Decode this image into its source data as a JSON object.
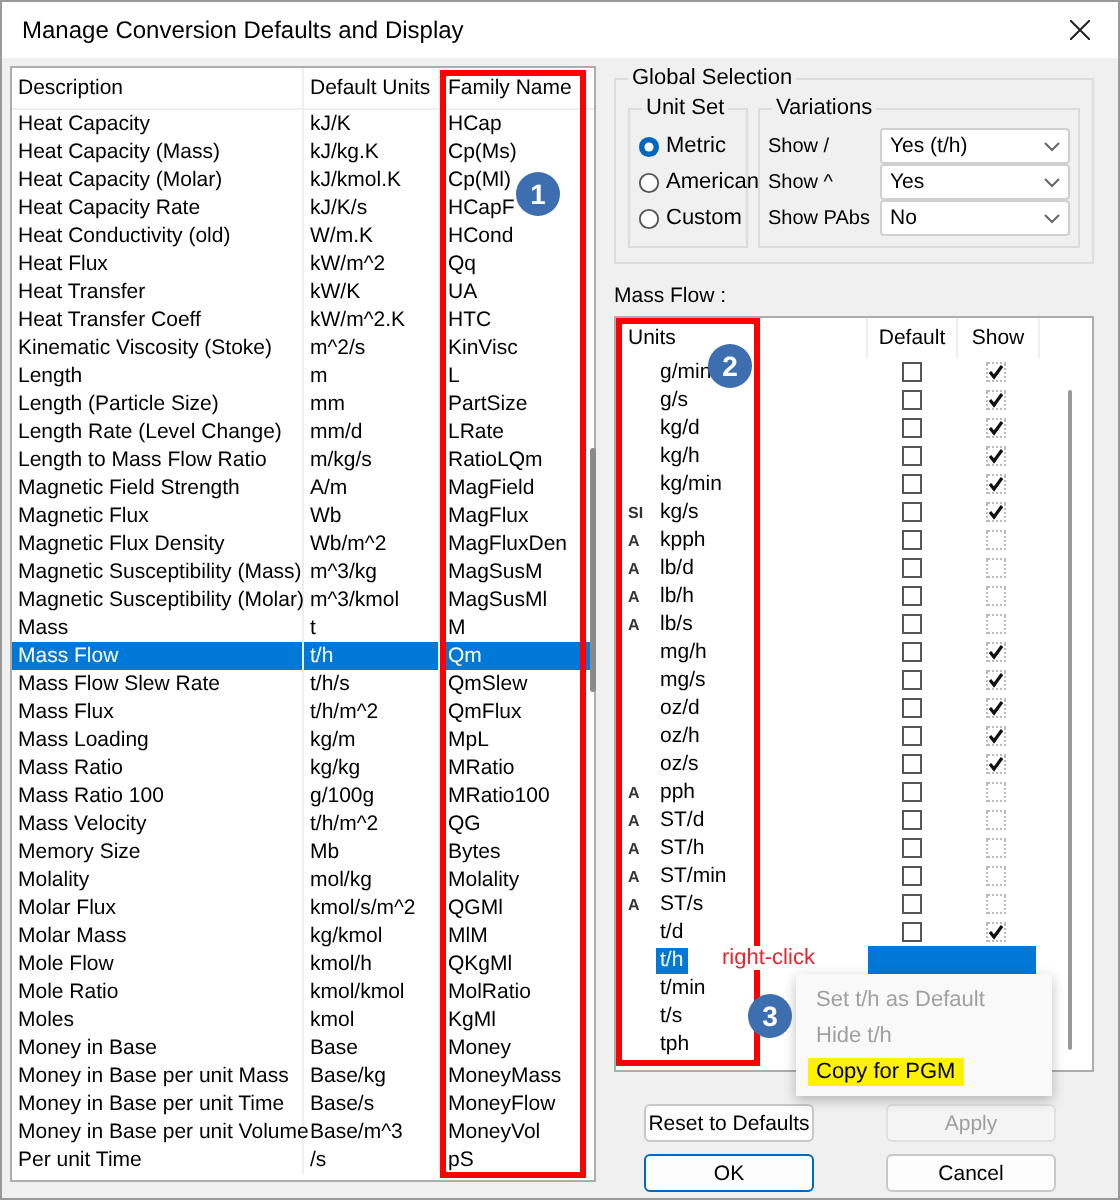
{
  "window": {
    "title": "Manage Conversion Defaults and Display"
  },
  "family_table": {
    "columns": [
      "Description",
      "Default Units",
      "Family Name"
    ],
    "rows": [
      {
        "description": "Heat Capacity",
        "default_units": "kJ/K",
        "family_name": "HCap",
        "selected": false
      },
      {
        "description": "Heat Capacity (Mass)",
        "default_units": "kJ/kg.K",
        "family_name": "Cp(Ms)",
        "selected": false
      },
      {
        "description": "Heat Capacity (Molar)",
        "default_units": "kJ/kmol.K",
        "family_name": "Cp(Ml)",
        "selected": false
      },
      {
        "description": "Heat Capacity Rate",
        "default_units": "kJ/K/s",
        "family_name": "HCapF",
        "selected": false
      },
      {
        "description": "Heat Conductivity (old)",
        "default_units": "W/m.K",
        "family_name": "HCond",
        "selected": false
      },
      {
        "description": "Heat Flux",
        "default_units": "kW/m^2",
        "family_name": "Qq",
        "selected": false
      },
      {
        "description": "Heat Transfer",
        "default_units": "kW/K",
        "family_name": "UA",
        "selected": false
      },
      {
        "description": "Heat Transfer Coeff",
        "default_units": "kW/m^2.K",
        "family_name": "HTC",
        "selected": false
      },
      {
        "description": "Kinematic Viscosity (Stoke)",
        "default_units": "m^2/s",
        "family_name": "KinVisc",
        "selected": false
      },
      {
        "description": "Length",
        "default_units": "m",
        "family_name": "L",
        "selected": false
      },
      {
        "description": "Length (Particle Size)",
        "default_units": "mm",
        "family_name": "PartSize",
        "selected": false
      },
      {
        "description": "Length Rate (Level Change)",
        "default_units": "mm/d",
        "family_name": "LRate",
        "selected": false
      },
      {
        "description": "Length to Mass Flow Ratio",
        "default_units": "m/kg/s",
        "family_name": "RatioLQm",
        "selected": false
      },
      {
        "description": "Magnetic Field Strength",
        "default_units": "A/m",
        "family_name": "MagField",
        "selected": false
      },
      {
        "description": "Magnetic Flux",
        "default_units": "Wb",
        "family_name": "MagFlux",
        "selected": false
      },
      {
        "description": "Magnetic Flux Density",
        "default_units": "Wb/m^2",
        "family_name": "MagFluxDen",
        "selected": false
      },
      {
        "description": "Magnetic Susceptibility (Mass)",
        "default_units": "m^3/kg",
        "family_name": "MagSusM",
        "selected": false
      },
      {
        "description": "Magnetic Susceptibility (Molar)",
        "default_units": "m^3/kmol",
        "family_name": "MagSusMl",
        "selected": false
      },
      {
        "description": "Mass",
        "default_units": "t",
        "family_name": "M",
        "selected": false
      },
      {
        "description": "Mass Flow",
        "default_units": "t/h",
        "family_name": "Qm",
        "selected": true
      },
      {
        "description": "Mass Flow Slew Rate",
        "default_units": "t/h/s",
        "family_name": "QmSlew",
        "selected": false
      },
      {
        "description": "Mass Flux",
        "default_units": "t/h/m^2",
        "family_name": "QmFlux",
        "selected": false
      },
      {
        "description": "Mass Loading",
        "default_units": "kg/m",
        "family_name": "MpL",
        "selected": false
      },
      {
        "description": "Mass Ratio",
        "default_units": "kg/kg",
        "family_name": "MRatio",
        "selected": false
      },
      {
        "description": "Mass Ratio 100",
        "default_units": "g/100g",
        "family_name": "MRatio100",
        "selected": false
      },
      {
        "description": "Mass Velocity",
        "default_units": "t/h/m^2",
        "family_name": "QG",
        "selected": false
      },
      {
        "description": "Memory Size",
        "default_units": "Mb",
        "family_name": "Bytes",
        "selected": false
      },
      {
        "description": "Molality",
        "default_units": "mol/kg",
        "family_name": "Molality",
        "selected": false
      },
      {
        "description": "Molar Flux",
        "default_units": "kmol/s/m^2",
        "family_name": "QGMl",
        "selected": false
      },
      {
        "description": "Molar Mass",
        "default_units": "kg/kmol",
        "family_name": "MlM",
        "selected": false
      },
      {
        "description": "Mole Flow",
        "default_units": "kmol/h",
        "family_name": "QKgMl",
        "selected": false
      },
      {
        "description": "Mole Ratio",
        "default_units": "kmol/kmol",
        "family_name": "MolRatio",
        "selected": false
      },
      {
        "description": "Moles",
        "default_units": "kmol",
        "family_name": "KgMl",
        "selected": false
      },
      {
        "description": "Money in Base",
        "default_units": "Base",
        "family_name": "Money",
        "selected": false
      },
      {
        "description": "Money in Base per unit Mass",
        "default_units": "Base/kg",
        "family_name": "MoneyMass",
        "selected": false
      },
      {
        "description": "Money in Base per unit Time",
        "default_units": "Base/s",
        "family_name": "MoneyFlow",
        "selected": false
      },
      {
        "description": "Money in Base per unit Volume",
        "default_units": "Base/m^3",
        "family_name": "MoneyVol",
        "selected": false
      },
      {
        "description": "Per unit Time",
        "default_units": "/s",
        "family_name": "pS",
        "selected": false
      }
    ]
  },
  "global_selection": {
    "title": "Global Selection",
    "unit_set": {
      "title": "Unit Set",
      "options": [
        {
          "label": "Metric",
          "selected": true
        },
        {
          "label": "American",
          "selected": false
        },
        {
          "label": "Custom",
          "selected": false
        }
      ]
    },
    "variations": {
      "title": "Variations",
      "rows": [
        {
          "label": "Show /",
          "value": "Yes (t/h)"
        },
        {
          "label": "Show ^",
          "value": "Yes"
        },
        {
          "label": "Show PAbs",
          "value": "No"
        }
      ]
    }
  },
  "units_panel": {
    "title": "Mass Flow :",
    "columns": [
      "Units",
      "Default",
      "Show"
    ],
    "rows": [
      {
        "unit": "g/min",
        "default": false,
        "show": true,
        "selected": false
      },
      {
        "unit": "g/s",
        "default": false,
        "show": true,
        "selected": false
      },
      {
        "unit": "kg/d",
        "default": false,
        "show": true,
        "selected": false
      },
      {
        "unit": "kg/h",
        "default": false,
        "show": true,
        "selected": false
      },
      {
        "unit": "kg/min",
        "default": false,
        "show": true,
        "selected": false
      },
      {
        "tag": "SI",
        "unit": "kg/s",
        "default": false,
        "show": true,
        "selected": false
      },
      {
        "tag": "A",
        "unit": "kpph",
        "default": false,
        "show": false,
        "selected": false
      },
      {
        "tag": "A",
        "unit": "lb/d",
        "default": false,
        "show": false,
        "selected": false
      },
      {
        "tag": "A",
        "unit": "lb/h",
        "default": false,
        "show": false,
        "selected": false
      },
      {
        "tag": "A",
        "unit": "lb/s",
        "default": false,
        "show": false,
        "selected": false
      },
      {
        "unit": "mg/h",
        "default": false,
        "show": true,
        "selected": false
      },
      {
        "unit": "mg/s",
        "default": false,
        "show": true,
        "selected": false
      },
      {
        "unit": "oz/d",
        "default": false,
        "show": true,
        "selected": false
      },
      {
        "unit": "oz/h",
        "default": false,
        "show": true,
        "selected": false
      },
      {
        "unit": "oz/s",
        "default": false,
        "show": true,
        "selected": false
      },
      {
        "tag": "A",
        "unit": "pph",
        "default": false,
        "show": false,
        "selected": false
      },
      {
        "tag": "A",
        "unit": "ST/d",
        "default": false,
        "show": false,
        "selected": false
      },
      {
        "tag": "A",
        "unit": "ST/h",
        "default": false,
        "show": false,
        "selected": false
      },
      {
        "tag": "A",
        "unit": "ST/min",
        "default": false,
        "show": false,
        "selected": false
      },
      {
        "tag": "A",
        "unit": "ST/s",
        "default": false,
        "show": false,
        "selected": false
      },
      {
        "unit": "t/d",
        "default": false,
        "show": true,
        "selected": false
      },
      {
        "unit": "t/h",
        "selected": true
      },
      {
        "unit": "t/min",
        "selected": false
      },
      {
        "unit": "t/s",
        "selected": false
      },
      {
        "unit": "tph",
        "selected": false
      }
    ]
  },
  "context_menu": {
    "items": [
      {
        "label": "Set t/h as Default",
        "disabled": true,
        "highlighted": false
      },
      {
        "label": "Hide t/h",
        "disabled": true,
        "highlighted": false
      },
      {
        "label": "Copy for PGM",
        "disabled": false,
        "highlighted": true
      }
    ]
  },
  "annotations": {
    "badges": [
      "1",
      "2",
      "3"
    ],
    "callout": "right-click"
  },
  "buttons": [
    {
      "label": "Reset to Defaults",
      "disabled": false,
      "default": false
    },
    {
      "label": "Apply",
      "disabled": true,
      "default": false
    },
    {
      "label": "OK",
      "disabled": false,
      "default": true
    },
    {
      "label": "Cancel",
      "disabled": false,
      "default": false
    }
  ]
}
